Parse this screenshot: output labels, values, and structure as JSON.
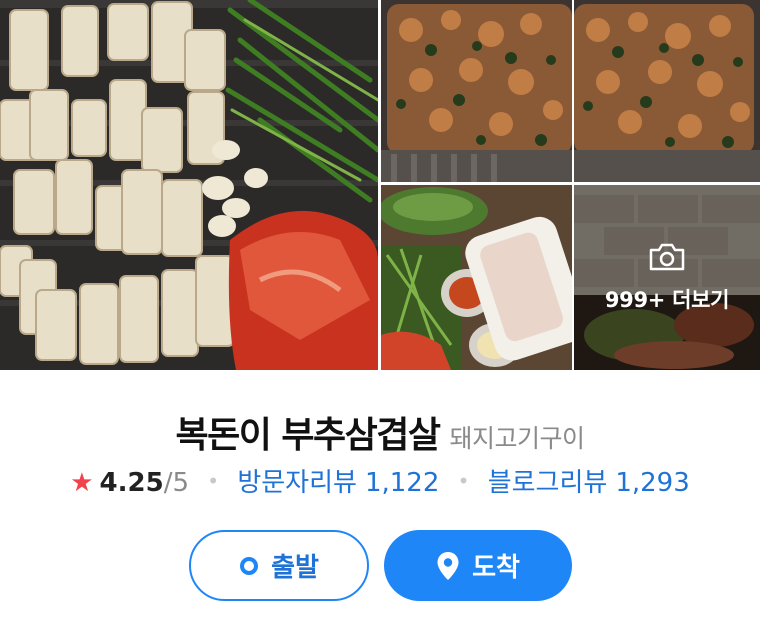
{
  "gallery": {
    "more_label": "999+ 더보기",
    "photos": [
      "pork-belly-grill",
      "fried-rice-grill",
      "fried-rice-grill",
      "vegetables-sauce-platter",
      "table-overview"
    ]
  },
  "place": {
    "name": "복돈이 부추삼겹살",
    "category": "돼지고기구이"
  },
  "rating": {
    "value": "4.25",
    "max": "/5"
  },
  "reviews": {
    "visit_label": "방문자리뷰",
    "visit_count": "1,122",
    "blog_label": "블로그리뷰",
    "blog_count": "1,293"
  },
  "buttons": {
    "depart_label": "출발",
    "arrive_label": "도착"
  },
  "colors": {
    "accent": "#1f86f7",
    "link": "#1f72d6",
    "star": "#f2424d",
    "muted": "#8a8a8a"
  }
}
